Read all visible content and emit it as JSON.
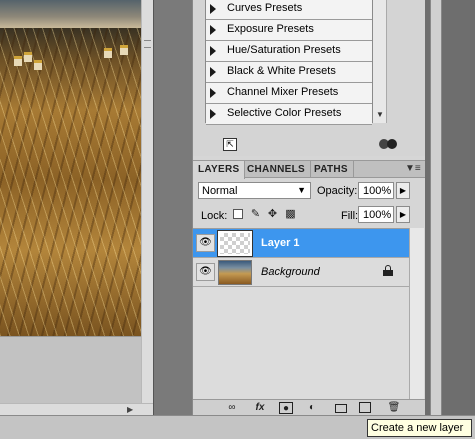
{
  "adjustments": {
    "presets": [
      "Curves Presets",
      "Exposure Presets",
      "Hue/Saturation Presets",
      "Black & White Presets",
      "Channel Mixer Presets",
      "Selective Color Presets"
    ]
  },
  "layers_panel": {
    "tabs": [
      "LAYERS",
      "CHANNELS",
      "PATHS"
    ],
    "blend_mode": "Normal",
    "opacity_label": "Opacity:",
    "opacity_value": "100%",
    "lock_label": "Lock:",
    "fill_label": "Fill:",
    "fill_value": "100%",
    "layers": [
      {
        "name": "Layer 1",
        "selected": true
      },
      {
        "name": "Background",
        "selected": false
      }
    ]
  },
  "bottom_icons": [
    "link-icon",
    "fx-icon",
    "mask-icon",
    "adjustment-icon",
    "group-folder-icon",
    "new-layer-icon",
    "trash-icon"
  ],
  "bottom_fx_label": "fx",
  "tooltip": "Create a new layer",
  "colors": {
    "selection": "#3d96ee",
    "panel_bg": "#d6d6d6"
  }
}
